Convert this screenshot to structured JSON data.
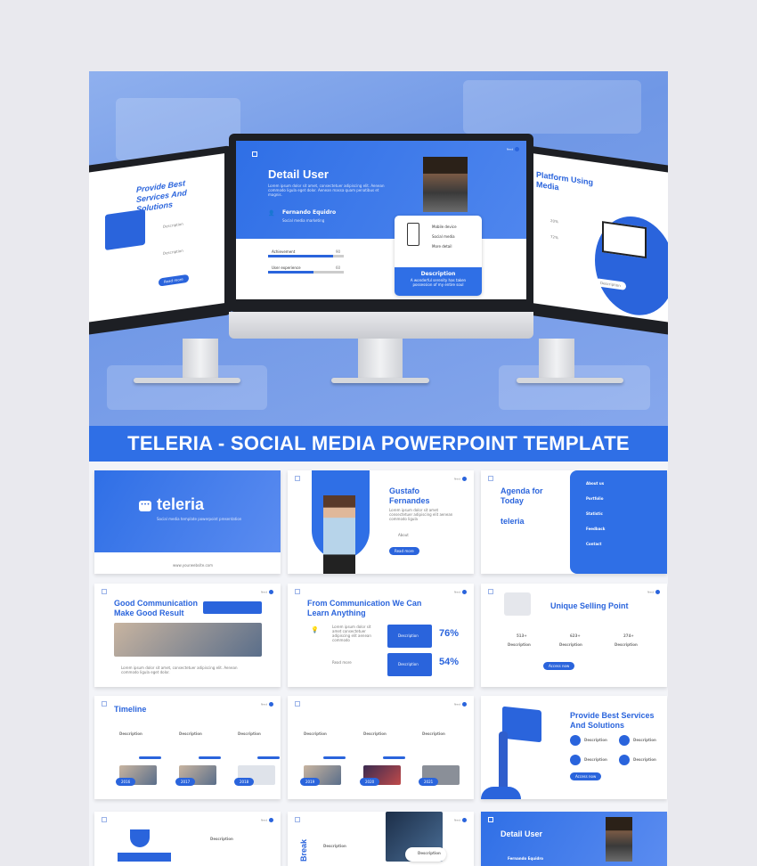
{
  "hero": {
    "center_slide": {
      "title": "Detail User",
      "body": "Lorem ipsum dolor sit amet, consectetuer adipiscing elit. Aenean commodo ligula eget dolor. Aenean massa quam penatibus et magnis.",
      "user_name": "Fernando Equidro",
      "user_role": "Social media marketing",
      "next_label": "Next",
      "stats": [
        {
          "label": "Achievement",
          "value": "90",
          "progress": 0.86
        },
        {
          "label": "User experience",
          "value": "60",
          "progress": 0.6
        }
      ],
      "features": [
        "Mobile device",
        "Social media",
        "More detail"
      ],
      "card_title": "Description",
      "card_text": "A wonderful serenity has taken possession of my entire soul"
    },
    "left_slide": {
      "title": "Provide Best Services And Solutions",
      "items": [
        "Description",
        "Description"
      ],
      "button": "Read more"
    },
    "right_slide": {
      "title": "Platform Using Media",
      "stats": [
        "20%",
        "72%"
      ],
      "card_title": "Description"
    }
  },
  "banner": {
    "title": "TELERIA - SOCIAL MEDIA POWERPOINT TEMPLATE"
  },
  "slides": {
    "cover": {
      "brand": "teleria",
      "subtitle": "Social media template powerpoint presentation",
      "url": "www.yourwebsite.com"
    },
    "profile": {
      "name": "Gustafo Fernandes",
      "about": "About",
      "button": "Read more",
      "next": "Next"
    },
    "agenda": {
      "title": "Agenda for Today",
      "brand": "teleria",
      "items": [
        "About us",
        "Portfolio",
        "Statistic",
        "Feedback",
        "Contact"
      ]
    },
    "communication": {
      "title": "Good Communication Make Good Result",
      "next": "Next"
    },
    "learn": {
      "title": "From Communication We Can Learn Anything",
      "read_more": "Read more",
      "stats": [
        {
          "label": "Description",
          "value": "76%"
        },
        {
          "label": "Description",
          "value": "54%"
        }
      ],
      "next": "Next"
    },
    "usp": {
      "title": "Unique Selling Point",
      "stats": [
        {
          "value": "513+",
          "label": "Description"
        },
        {
          "value": "623+",
          "label": "Description"
        },
        {
          "value": "274+",
          "label": "Description"
        }
      ],
      "button": "Access now",
      "next": "Next"
    },
    "timeline": {
      "title": "Timeline",
      "items": [
        "Description",
        "Description",
        "Description"
      ],
      "years": [
        "2016",
        "2017",
        "2018"
      ],
      "next": "Next"
    },
    "timeline2": {
      "items": [
        "Description",
        "Description",
        "Description"
      ],
      "years": [
        "2019",
        "2020",
        "2021"
      ],
      "next": "Next"
    },
    "services": {
      "title": "Provide Best Services And Solutions",
      "items": [
        "Description",
        "Description",
        "Description",
        "Description"
      ],
      "button": "Access now"
    },
    "award": {
      "label": "Description",
      "next": "Next"
    },
    "break": {
      "title": "Break",
      "label": "Description",
      "card": "Description",
      "next": "Next"
    },
    "detail": {
      "title": "Detail User",
      "name": "Fernando Equidro"
    }
  },
  "colors": {
    "accent": "#2a64dc",
    "banner": "#2f6fe6"
  }
}
